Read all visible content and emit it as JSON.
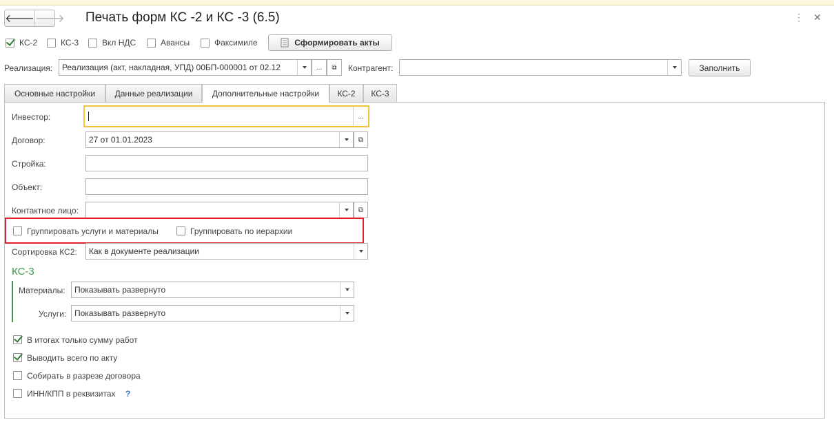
{
  "window": {
    "title": "Печать форм КС -2 и КС -3 (6.5)",
    "nav_back": "🡐",
    "nav_forward": "🡒",
    "menu_icon": "⋮",
    "close_icon": "✕"
  },
  "toolbar": {
    "ks2": {
      "label": "КС-2",
      "checked": true
    },
    "ks3": {
      "label": "КС-3",
      "checked": false
    },
    "vat": {
      "label": "Вкл НДС",
      "checked": false
    },
    "advances": {
      "label": "Авансы",
      "checked": false
    },
    "facsimile": {
      "label": "Факсимиле",
      "checked": false
    },
    "generate_label": "Сформировать акты"
  },
  "header": {
    "realization_label": "Реализация:",
    "realization_value": "Реализация (акт, накладная, УПД) 00БП-000001 от 02.12",
    "contractor_label": "Контрагент:",
    "contractor_value": "",
    "fill_label": "Заполнить"
  },
  "tabs": [
    {
      "label": "Основные настройки"
    },
    {
      "label": "Данные реализации"
    },
    {
      "label": "Дополнительные настройки",
      "active": true
    },
    {
      "label": "КС-2"
    },
    {
      "label": "КС-3"
    }
  ],
  "form": {
    "investor": {
      "label": "Инвестор:",
      "value": ""
    },
    "contract": {
      "label": "Договор:",
      "value": "27 от 01.01.2023"
    },
    "construction": {
      "label": "Стройка:",
      "value": ""
    },
    "object": {
      "label": "Объект:",
      "value": ""
    },
    "contact": {
      "label": "Контактное лицо:",
      "value": ""
    },
    "group_services": {
      "label": "Группировать услуги и материалы",
      "checked": false
    },
    "group_hierarchy": {
      "label": "Группировать по иерархии",
      "checked": false
    },
    "sort": {
      "label": "Сортировка КС2:",
      "value": "Как в документе реализации"
    }
  },
  "ks3_section": {
    "title": "КС-3",
    "materials": {
      "label": "Материалы:",
      "value": "Показывать развернуто"
    },
    "services": {
      "label": "Услуги:",
      "value": "Показывать развернуто"
    }
  },
  "options": {
    "works_only": {
      "label": "В итогах только сумму работ",
      "checked": true
    },
    "total_act": {
      "label": "Выводить всего по акту",
      "checked": true
    },
    "by_contract": {
      "label": "Собирать в разрезе договора",
      "checked": false
    },
    "inn_kpp": {
      "label": "ИНН/КПП в реквизитах",
      "checked": false
    },
    "help": "?"
  },
  "colors": {
    "accent_green": "#3a9a4a",
    "highlight_red": "#e0202a",
    "focus_yellow": "#f2c33c"
  }
}
